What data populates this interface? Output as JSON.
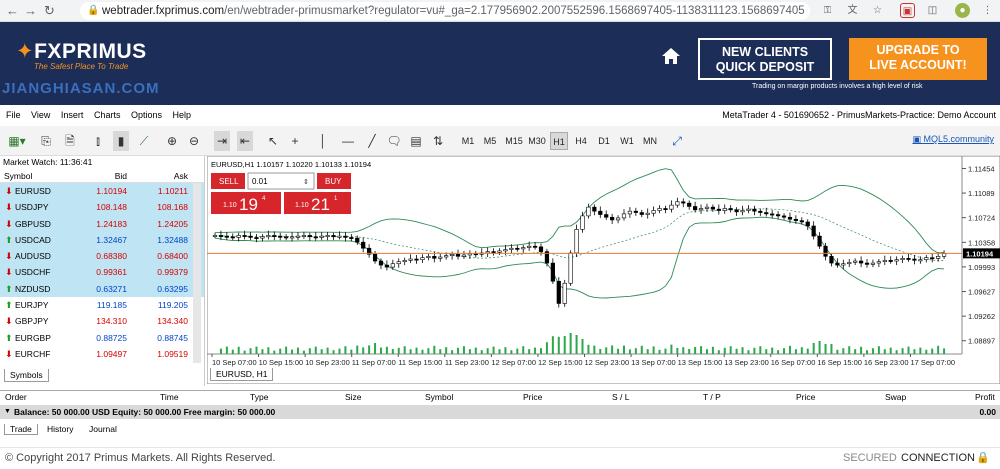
{
  "browser": {
    "url_domain": "webtrader.fxprimus.com",
    "url_rest": "/en/webtrader-primusmarket?regulator=vu#_ga=2.177956902.2007552596.1568697405-1138311123.1568697405"
  },
  "header": {
    "logo_text": "FXPRIMUS",
    "tagline": "The Safest Place To Trade",
    "watermark": "JIANGHIASAN.COM",
    "deposit_line1": "NEW CLIENTS",
    "deposit_line2": "QUICK DEPOSIT",
    "upgrade_line1": "UPGRADE TO",
    "upgrade_line2": "LIVE ACCOUNT!",
    "risk_text": "Trading on margin products involves a high level of risk"
  },
  "menu": {
    "items": [
      "File",
      "View",
      "Insert",
      "Charts",
      "Options",
      "Help"
    ],
    "account": "MetaTrader 4 - 501690652 - PrimusMarkets-Practice: Demo Account"
  },
  "toolbar": {
    "timeframes": [
      "M1",
      "M5",
      "M15",
      "M30",
      "H1",
      "H4",
      "D1",
      "W1",
      "MN"
    ],
    "active_timeframe": "H1",
    "mql5": "MQL5.community"
  },
  "market_watch": {
    "title": "Market Watch: 11:36:41",
    "col_symbol": "Symbol",
    "col_bid": "Bid",
    "col_ask": "Ask",
    "rows": [
      {
        "symbol": "EURUSD",
        "bid": "1.10194",
        "ask": "1.10211",
        "dir": "down"
      },
      {
        "symbol": "USDJPY",
        "bid": "108.148",
        "ask": "108.168",
        "dir": "down"
      },
      {
        "symbol": "GBPUSD",
        "bid": "1.24183",
        "ask": "1.24205",
        "dir": "down"
      },
      {
        "symbol": "USDCAD",
        "bid": "1.32467",
        "ask": "1.32488",
        "dir": "up"
      },
      {
        "symbol": "AUDUSD",
        "bid": "0.68380",
        "ask": "0.68400",
        "dir": "down"
      },
      {
        "symbol": "USDCHF",
        "bid": "0.99361",
        "ask": "0.99379",
        "dir": "down"
      },
      {
        "symbol": "NZDUSD",
        "bid": "0.63271",
        "ask": "0.63295",
        "dir": "up"
      },
      {
        "symbol": "EURJPY",
        "bid": "119.185",
        "ask": "119.205",
        "dir": "up"
      },
      {
        "symbol": "GBPJPY",
        "bid": "134.310",
        "ask": "134.340",
        "dir": "down"
      },
      {
        "symbol": "EURGBP",
        "bid": "0.88725",
        "ask": "0.88745",
        "dir": "up"
      },
      {
        "symbol": "EURCHF",
        "bid": "1.09497",
        "ask": "1.09519",
        "dir": "down"
      }
    ],
    "tab": "Symbols"
  },
  "chart": {
    "info": "EURUSD,H1  1.10157 1.10220 1.10133 1.10194",
    "sell_label": "SELL",
    "buy_label": "BUY",
    "lot": "0.01",
    "sell_small": "1.10",
    "sell_big": "19",
    "sell_sup": "4",
    "buy_small": "1.10",
    "buy_big": "21",
    "buy_sup": "1",
    "current_price": "1.10194",
    "tab": "EURUSD, H1"
  },
  "chart_data": {
    "type": "candlestick",
    "symbol": "EURUSD",
    "ylim": [
      1.087,
      1.1155
    ],
    "y_ticks": [
      "1.11454",
      "1.11089",
      "1.10724",
      "1.10358",
      "1.09993",
      "1.09627",
      "1.09262",
      "1.08897"
    ],
    "x_ticks": [
      "10 Sep 07:00",
      "10 Sep 15:00",
      "10 Sep 23:00",
      "11 Sep 07:00",
      "11 Sep 15:00",
      "11 Sep 23:00",
      "12 Sep 07:00",
      "12 Sep 15:00",
      "12 Sep 23:00",
      "13 Sep 07:00",
      "13 Sep 15:00",
      "13 Sep 23:00",
      "16 Sep 07:00",
      "16 Sep 15:00",
      "16 Sep 23:00",
      "17 Sep 07:00"
    ],
    "close": [
      1.1046,
      1.1045,
      1.1044,
      1.1043,
      1.1046,
      1.1045,
      1.1043,
      1.1042,
      1.1044,
      1.1046,
      1.1045,
      1.1044,
      1.1043,
      1.1044,
      1.1045,
      1.1046,
      1.1044,
      1.1043,
      1.1045,
      1.1046,
      1.1044,
      1.1045,
      1.1043,
      1.1042,
      1.1036,
      1.1027,
      1.1018,
      1.1008,
      1.1002,
      1.0999,
      1.1004,
      1.1007,
      1.1009,
      1.1011,
      1.101,
      1.1013,
      1.1015,
      1.1012,
      1.1014,
      1.1016,
      1.1018,
      1.1015,
      1.1017,
      1.1019,
      1.1018,
      1.102,
      1.1022,
      1.1021,
      1.1023,
      1.1025,
      1.1027,
      1.1026,
      1.1028,
      1.103,
      1.1029,
      1.1022,
      1.1005,
      1.0978,
      1.0945,
      1.0975,
      1.102,
      1.1055,
      1.1075,
      1.1088,
      1.1082,
      1.1077,
      1.1073,
      1.1069,
      1.1072,
      1.1078,
      1.1082,
      1.108,
      1.1077,
      1.1079,
      1.1083,
      1.1086,
      1.1085,
      1.1091,
      1.1096,
      1.1094,
      1.1089,
      1.1084,
      1.1086,
      1.1088,
      1.1085,
      1.1083,
      1.1086,
      1.1084,
      1.1081,
      1.1083,
      1.1085,
      1.1082,
      1.108,
      1.1078,
      1.1077,
      1.1075,
      1.1073,
      1.107,
      1.1068,
      1.1066,
      1.106,
      1.1045,
      1.103,
      1.1015,
      1.1005,
      1.1002,
      1.1004,
      1.1006,
      1.1008,
      1.1005,
      1.1003,
      1.1005,
      1.1007,
      1.1009,
      1.1008,
      1.101,
      1.1012,
      1.1011,
      1.1009,
      1.101,
      1.1013,
      1.1012,
      1.1015,
      1.1019
    ],
    "series": [
      {
        "name": "Bollinger Bands",
        "values": []
      }
    ]
  },
  "trade": {
    "columns": [
      "Order",
      "Time",
      "Type",
      "Size",
      "Symbol",
      "Price",
      "S / L",
      "T / P",
      "Price",
      "Swap",
      "Profit"
    ],
    "balance_text": "Balance: 50 000.00 USD  Equity: 50 000.00  Free margin: 50 000.00",
    "profit_total": "0.00",
    "tabs": [
      "Trade",
      "History",
      "Journal"
    ]
  },
  "footer": {
    "copyright": "© Copyright 2017 Primus Markets. All Rights Reserved.",
    "secured": "SECURED",
    "connection": "CONNECTION"
  },
  "colors": {
    "header_bg": "#1c2d58",
    "accent_orange": "#f6921e",
    "sell_red": "#d6252b",
    "bid_red": "#d60000",
    "ask_blue": "#0044cc",
    "highlight_row": "#bfe4f3",
    "band_green": "#2e8b57",
    "price_line": "#e07b39"
  }
}
